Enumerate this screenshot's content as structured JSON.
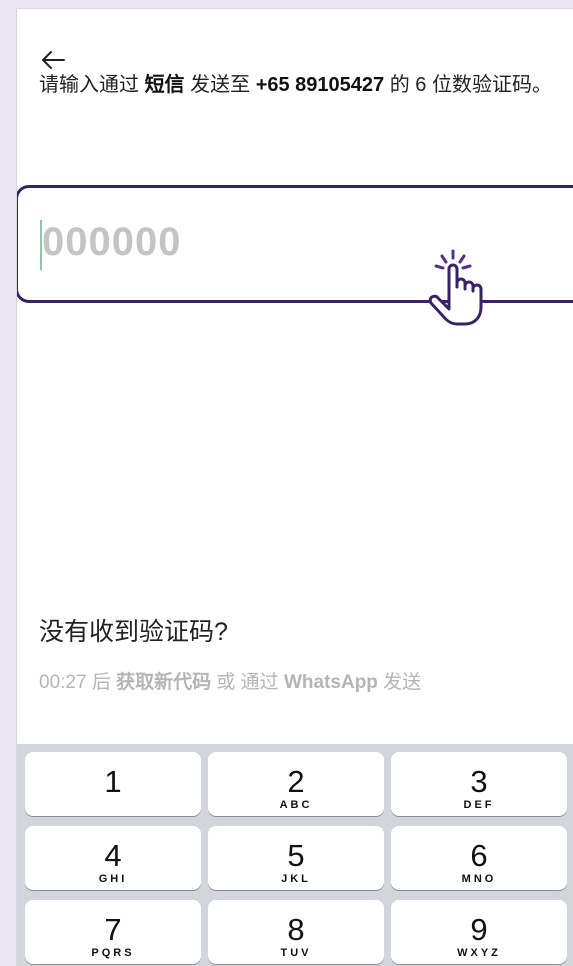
{
  "header": {
    "back_icon": "arrow-left-icon",
    "instruction": {
      "part1": "请输入通过 ",
      "channel": "短信",
      "part2": " 发送至 ",
      "phone": "+65 89105427",
      "part3": " 的 6 位数验证码。"
    }
  },
  "code_input": {
    "placeholder": "000000",
    "cursor_icon": "hand-pointer-icon"
  },
  "help": {
    "title": "没有收到验证码?",
    "countdown": "00:27",
    "after_text": " 后 ",
    "resend_link": "获取新代码",
    "or_text": " 或 通过 ",
    "whatsapp_link": "WhatsApp",
    "send_text": " 发送"
  },
  "keypad": {
    "keys": [
      {
        "num": "1",
        "letters": ""
      },
      {
        "num": "2",
        "letters": "ABC"
      },
      {
        "num": "3",
        "letters": "DEF"
      },
      {
        "num": "4",
        "letters": "GHI"
      },
      {
        "num": "5",
        "letters": "JKL"
      },
      {
        "num": "6",
        "letters": "MNO"
      },
      {
        "num": "7",
        "letters": "PQRS"
      },
      {
        "num": "8",
        "letters": "TUV"
      },
      {
        "num": "9",
        "letters": "WXYZ"
      }
    ]
  },
  "colors": {
    "accent": "#3a2266",
    "placeholder": "#c4c4c4",
    "hint_text": "#b5b5b5",
    "keypad_bg": "#d2d5dc",
    "outer_bg": "#e9e5f2"
  }
}
